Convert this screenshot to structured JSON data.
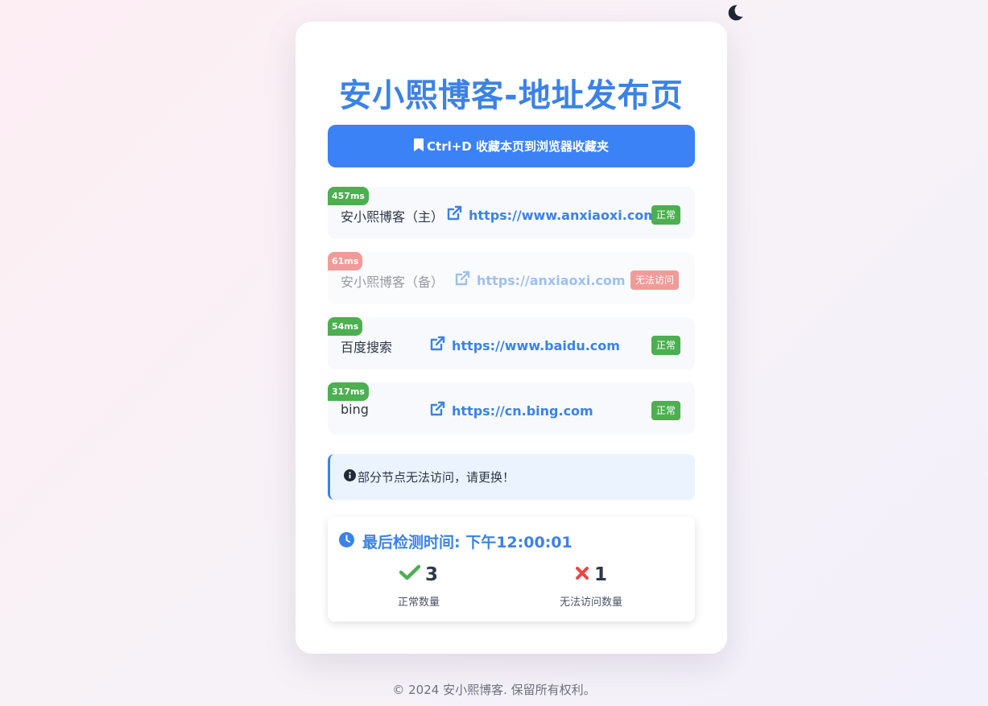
{
  "theme_toggle": {
    "icon": "moon-icon"
  },
  "title": "安小熙博客-地址发布页",
  "bookmark_button": {
    "label": "Ctrl+D 收藏本页到浏览器收藏夹",
    "icon": "bookmark-icon"
  },
  "nodes": [
    {
      "latency": "457ms",
      "name": "安小熙博客（主）",
      "url": "https://www.anxiaoxi.com",
      "status": "正常",
      "ok": true
    },
    {
      "latency": "61ms",
      "name": "安小熙博客（备）",
      "url": "https://anxiaoxi.com",
      "status": "无法访问",
      "ok": false
    },
    {
      "latency": "54ms",
      "name": "百度搜索",
      "url": "https://www.baidu.com",
      "status": "正常",
      "ok": true
    },
    {
      "latency": "317ms",
      "name": "bing",
      "url": "https://cn.bing.com",
      "status": "正常",
      "ok": true
    }
  ],
  "notice": {
    "icon": "info-icon",
    "text": "部分节点无法访问，请更换！"
  },
  "check": {
    "icon": "clock-icon",
    "text": "最后检测时间: 下午12:00:01"
  },
  "stats": {
    "ok_count": "3",
    "ok_label": "正常数量",
    "fail_count": "1",
    "fail_label": "无法访问数量"
  },
  "footer": "© 2024 安小熙博客. 保留所有权利。",
  "colors": {
    "accent": "#3b82e6",
    "button": "#3b82f6",
    "ok": "#4caf50",
    "fail": "#ef4444",
    "fail_badge": "#e53935"
  }
}
